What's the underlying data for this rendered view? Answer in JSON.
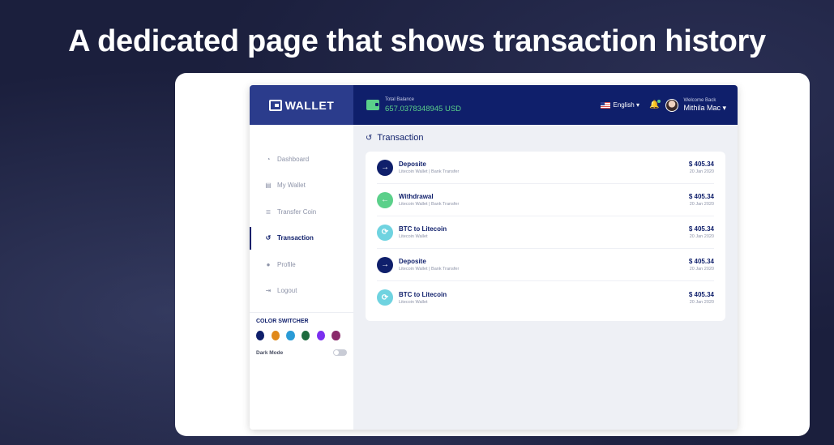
{
  "headline": "A dedicated page that shows transaction history",
  "brand": {
    "name": "WALLET"
  },
  "topbar": {
    "balance_label": "Total Balance",
    "balance_value": "657.0378348945 USD",
    "language": "English",
    "welcome_label": "Welcome Back",
    "user_name": "Mithila Mac"
  },
  "sidebar": {
    "items": [
      {
        "label": "Dashboard",
        "icon": "dashboard-icon",
        "glyph": "◔",
        "active": false
      },
      {
        "label": "My Wallet",
        "icon": "wallet-icon",
        "glyph": "▤",
        "active": false
      },
      {
        "label": "Transfer Coin",
        "icon": "coins-icon",
        "glyph": "≣",
        "active": false
      },
      {
        "label": "Transaction",
        "icon": "history-icon",
        "glyph": "↺",
        "active": true
      },
      {
        "label": "Profile",
        "icon": "user-icon",
        "glyph": "●",
        "active": false
      },
      {
        "label": "Logout",
        "icon": "logout-icon",
        "glyph": "⇥",
        "active": false
      }
    ],
    "color_switcher_title": "COLOR SWITCHER",
    "swatches": [
      "#0f1f6b",
      "#e0891a",
      "#2a9bd6",
      "#1e6b3e",
      "#7b2ff0",
      "#8a2a6b"
    ],
    "dark_mode_label": "Dark Mode",
    "dark_mode_on": false
  },
  "main": {
    "title": "Transaction",
    "transactions": [
      {
        "title": "Deposite",
        "subtitle": "Litecoin Wallet | Bank Transfer",
        "amount": "$ 405.34",
        "date": "20 Jan 2020",
        "icon": "arrow-right-icon",
        "glyph": "→",
        "color": "#0f1f6b"
      },
      {
        "title": "Withdrawal",
        "subtitle": "Litecoin Wallet | Bank Transfer",
        "amount": "$ 405.34",
        "date": "20 Jan 2020",
        "icon": "arrow-left-icon",
        "glyph": "←",
        "color": "#5bd08a"
      },
      {
        "title": "BTC to Litecoin",
        "subtitle": "Litecoin Wallet",
        "amount": "$ 405.34",
        "date": "20 Jan 2020",
        "icon": "exchange-icon",
        "glyph": "⟳",
        "color": "#6fd3e0"
      },
      {
        "title": "Deposite",
        "subtitle": "Litecoin Wallet | Bank Transfer",
        "amount": "$ 405.34",
        "date": "20 Jan 2020",
        "icon": "arrow-right-icon",
        "glyph": "→",
        "color": "#0f1f6b"
      },
      {
        "title": "BTC to Litecoin",
        "subtitle": "Litecoin Wallet",
        "amount": "$ 405.34",
        "date": "20 Jan 2020",
        "icon": "exchange-icon",
        "glyph": "⟳",
        "color": "#6fd3e0"
      }
    ]
  }
}
